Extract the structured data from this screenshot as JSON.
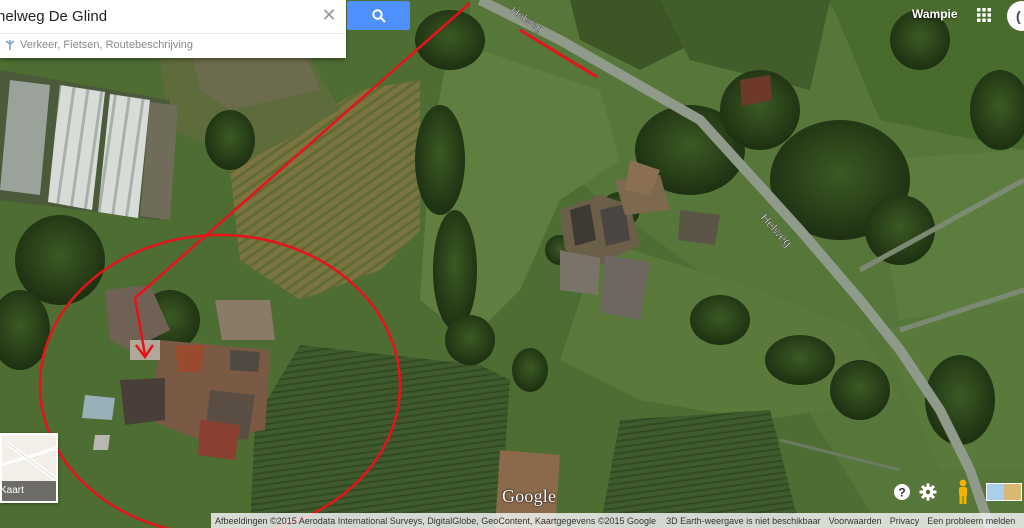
{
  "search": {
    "value": "helweg De Glind",
    "directions_label": "Verkeer, Fietsen, Routebeschrijving"
  },
  "user": {
    "name": "Wampie",
    "avatar_initial": "("
  },
  "map": {
    "road_label_1": "Helweg",
    "road_label_2": "Helweg",
    "logo": "Google",
    "mini_map_label": "Kaart"
  },
  "footer": {
    "attribution": "Afbeeldingen ©2015 Aerodata International Surveys, DigitalGlobe, GeoContent, Kaartgegevens ©2015 Google",
    "earth_notice": "3D Earth-weergave is niet beschikbaar",
    "terms": "Voorwaarden",
    "privacy": "Privacy",
    "report": "Een probleem melden"
  },
  "colors": {
    "search_button": "#4d90fe",
    "annotation_red": "#e8121b",
    "road": "#8f9a8a"
  },
  "icons": [
    "search-icon",
    "close-icon",
    "directions-icon",
    "apps-grid-icon",
    "help-icon",
    "settings-icon",
    "pegman-icon"
  ]
}
